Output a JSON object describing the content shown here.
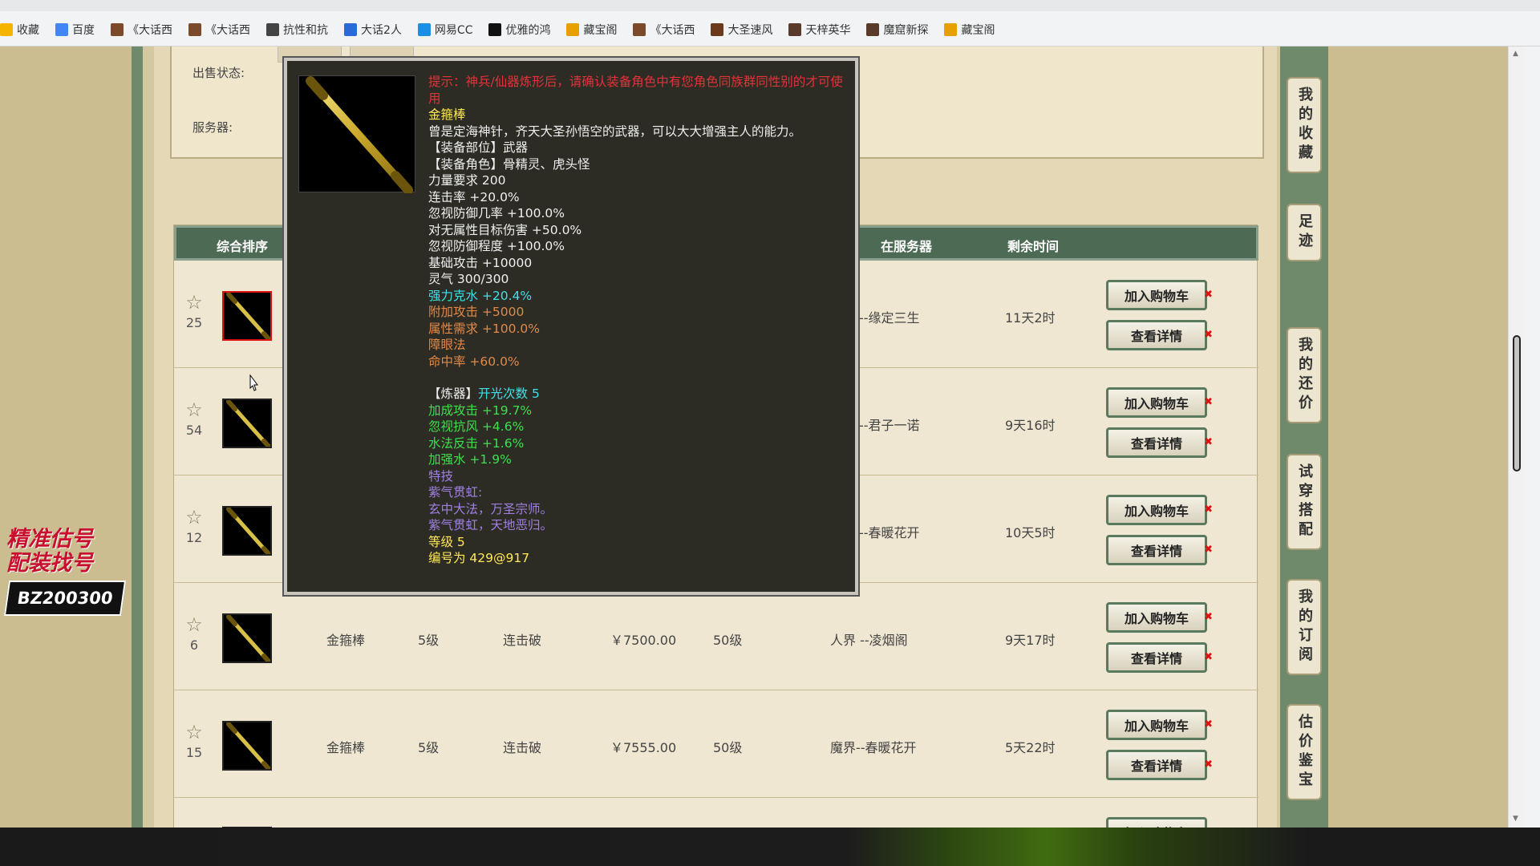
{
  "bookmarks": [
    "收藏",
    "百度",
    "《大话西",
    "《大话西",
    "抗性和抗",
    "大话2人",
    "网易CC",
    "优雅的鸿",
    "藏宝阁",
    "《大话西",
    "大圣速风",
    "天梓英华",
    "魔窟新探",
    "藏宝阁"
  ],
  "filter": {
    "status_label": "出售状态:",
    "server_label": "服务器:"
  },
  "table": {
    "headers": [
      "综合排序",
      "在服务器",
      "剩余时间"
    ],
    "add_cart_label": "加入购物车",
    "detail_label": "查看详情",
    "rows": [
      {
        "rank": "25",
        "server": "--缘定三生",
        "time": "11天2时"
      },
      {
        "rank": "54",
        "server": "--君子一诺",
        "time": "9天16时"
      },
      {
        "rank": "12",
        "server": "--春暖花开",
        "time": "10天5时"
      },
      {
        "rank": "6",
        "name": "金箍棒",
        "level": "5级",
        "skill": "连击破",
        "price": "￥7500.00",
        "req": "50级",
        "server": "人界 --凌烟阁",
        "time": "9天17时"
      },
      {
        "rank": "15",
        "name": "金箍棒",
        "level": "5级",
        "skill": "连击破",
        "price": "￥7555.00",
        "req": "50级",
        "server": "魔界--春暖花开",
        "time": "5天22时"
      }
    ]
  },
  "promo": {
    "line1": "精准估号",
    "line2": "配装找号",
    "code": "BZ200300"
  },
  "right_nav": [
    "我的收藏",
    "足迹",
    "我的还价",
    "试穿搭配",
    "我的订阅",
    "估价鉴宝"
  ],
  "tooltip": {
    "hint": "提示：神兵/仙器炼形后，请确认装备角色中有您角色同族群同性别的才可使用",
    "name": "金箍棒",
    "desc": "曾是定海神针，齐天大圣孙悟空的武器，可以大大增强主人的能力。",
    "slot": "【装备部位】武器",
    "roles": "【装备角色】骨精灵、虎头怪",
    "white_stats": [
      "力量要求 200",
      "连击率 +20.0%",
      "忽视防御几率 +100.0%",
      "对无属性目标伤害 +50.0%",
      "忽视防御程度 +100.0%",
      "基础攻击 +10000",
      "灵气 300/300"
    ],
    "cyan_stat": "强力克水 +20.4%",
    "orange_stats": [
      "附加攻击 +5000",
      "属性需求 +100.0%",
      "障眼法",
      "命中率 +60.0%"
    ],
    "refine_label": "【炼器】",
    "refine_count": "开光次数 5",
    "green_stats": [
      "加成攻击 +19.7%",
      "忽视抗风 +4.6%",
      "水法反击 +1.6%",
      "加强水 +1.9%"
    ],
    "skill_title": "特技",
    "skill_lines": [
      "紫气贯虹:",
      "玄中大法，万圣宗师。",
      "紫气贯虹，天地恶归。"
    ],
    "grade": "等级 5",
    "serial": "编号为 429@917"
  }
}
